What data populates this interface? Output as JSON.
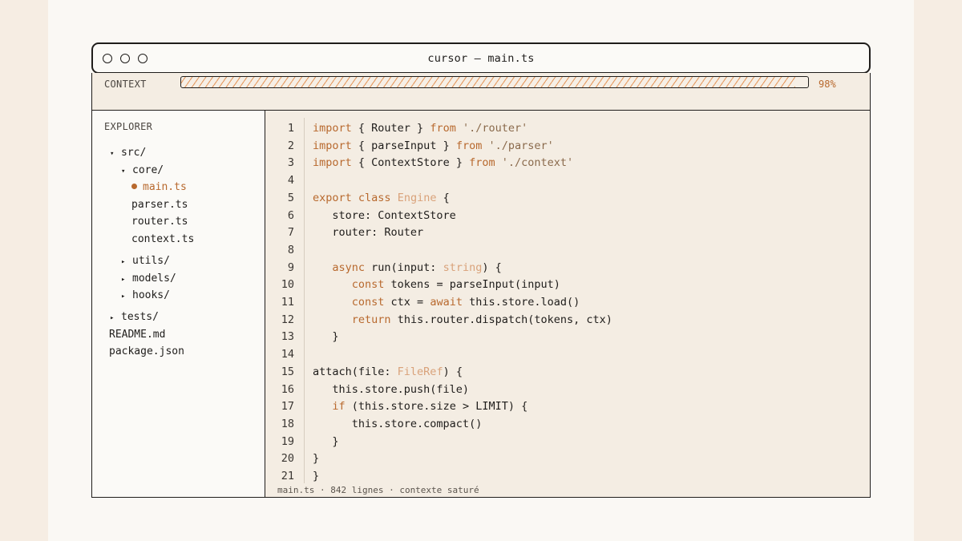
{
  "window": {
    "title": "cursor — main.ts"
  },
  "context": {
    "label": "CONTEXT",
    "percent_label": "98%",
    "fill": 0.98
  },
  "explorer": {
    "heading": "EXPLORER",
    "items": [
      {
        "label": "src/",
        "kind": "folder",
        "expanded": true,
        "depth": 0
      },
      {
        "label": "core/",
        "kind": "folder",
        "expanded": true,
        "depth": 1
      },
      {
        "label": "main.ts",
        "kind": "file",
        "active": true,
        "depth": 2
      },
      {
        "label": "parser.ts",
        "kind": "file",
        "depth": 2
      },
      {
        "label": "router.ts",
        "kind": "file",
        "depth": 2
      },
      {
        "label": "context.ts",
        "kind": "file",
        "depth": 2
      },
      {
        "label": "utils/",
        "kind": "folder",
        "expanded": false,
        "depth": 1
      },
      {
        "label": "models/",
        "kind": "folder",
        "expanded": false,
        "depth": 1
      },
      {
        "label": "hooks/",
        "kind": "folder",
        "expanded": false,
        "depth": 1
      },
      {
        "label": "tests/",
        "kind": "folder",
        "expanded": false,
        "depth": 0
      },
      {
        "label": "README.md",
        "kind": "file",
        "depth": 0
      },
      {
        "label": "package.json",
        "kind": "file",
        "depth": 0
      }
    ],
    "icons": {
      "expanded": "caret-down-icon",
      "collapsed": "caret-right-icon",
      "modified": "dot-icon"
    }
  },
  "editor": {
    "lines": [
      [
        [
          "kw",
          "import"
        ],
        [
          "t",
          " { Router } "
        ],
        [
          "kw",
          "from"
        ],
        [
          "t",
          " "
        ],
        [
          "str",
          "'./router'"
        ]
      ],
      [
        [
          "kw",
          "import"
        ],
        [
          "t",
          " { parseInput } "
        ],
        [
          "kw",
          "from"
        ],
        [
          "t",
          " "
        ],
        [
          "str",
          "'./parser'"
        ]
      ],
      [
        [
          "kw",
          "import"
        ],
        [
          "t",
          " { ContextStore } "
        ],
        [
          "kw",
          "from"
        ],
        [
          "t",
          " "
        ],
        [
          "str",
          "'./context'"
        ]
      ],
      [],
      [
        [
          "kw",
          "export class"
        ],
        [
          "t",
          " "
        ],
        [
          "ty",
          "Engine"
        ],
        [
          "t",
          " {"
        ]
      ],
      [
        [
          "t",
          "   store: ContextStore"
        ]
      ],
      [
        [
          "t",
          "   router: Router"
        ]
      ],
      [],
      [
        [
          "t",
          "   "
        ],
        [
          "kw",
          "async"
        ],
        [
          "t",
          " run(input: "
        ],
        [
          "ty",
          "string"
        ],
        [
          "t",
          ") {"
        ]
      ],
      [
        [
          "t",
          "      "
        ],
        [
          "kw",
          "const"
        ],
        [
          "t",
          " tokens = parseInput(input)"
        ]
      ],
      [
        [
          "t",
          "      "
        ],
        [
          "kw",
          "const"
        ],
        [
          "t",
          " ctx = "
        ],
        [
          "kw",
          "await"
        ],
        [
          "t",
          " this.store.load()"
        ]
      ],
      [
        [
          "t",
          "      "
        ],
        [
          "kw",
          "return"
        ],
        [
          "t",
          " this.router.dispatch(tokens, ctx)"
        ]
      ],
      [
        [
          "t",
          "   }"
        ]
      ],
      [],
      [
        [
          "t",
          "attach(file: "
        ],
        [
          "ty",
          "FileRef"
        ],
        [
          "t",
          ") {"
        ]
      ],
      [
        [
          "t",
          "   this.store.push(file)"
        ]
      ],
      [
        [
          "t",
          "   "
        ],
        [
          "kw",
          "if"
        ],
        [
          "t",
          " (this.store.size > LIMIT) {"
        ]
      ],
      [
        [
          "t",
          "      this.store.compact()"
        ]
      ],
      [
        [
          "t",
          "   }"
        ]
      ],
      [
        [
          "t",
          "}"
        ]
      ],
      [
        [
          "t",
          "}"
        ]
      ]
    ],
    "line_numbers": [
      "1",
      "2",
      "3",
      "4",
      "5",
      "6",
      "7",
      "8",
      "9",
      "10",
      "11",
      "12",
      "13",
      "14",
      "15",
      "16",
      "17",
      "18",
      "19",
      "20",
      "21"
    ],
    "status": "main.ts · 842 lignes · contexte saturé"
  },
  "colors": {
    "keyword": "#b8692e",
    "type": "#d9a27a",
    "string": "#8a6a4c",
    "accent": "#b8692e"
  }
}
